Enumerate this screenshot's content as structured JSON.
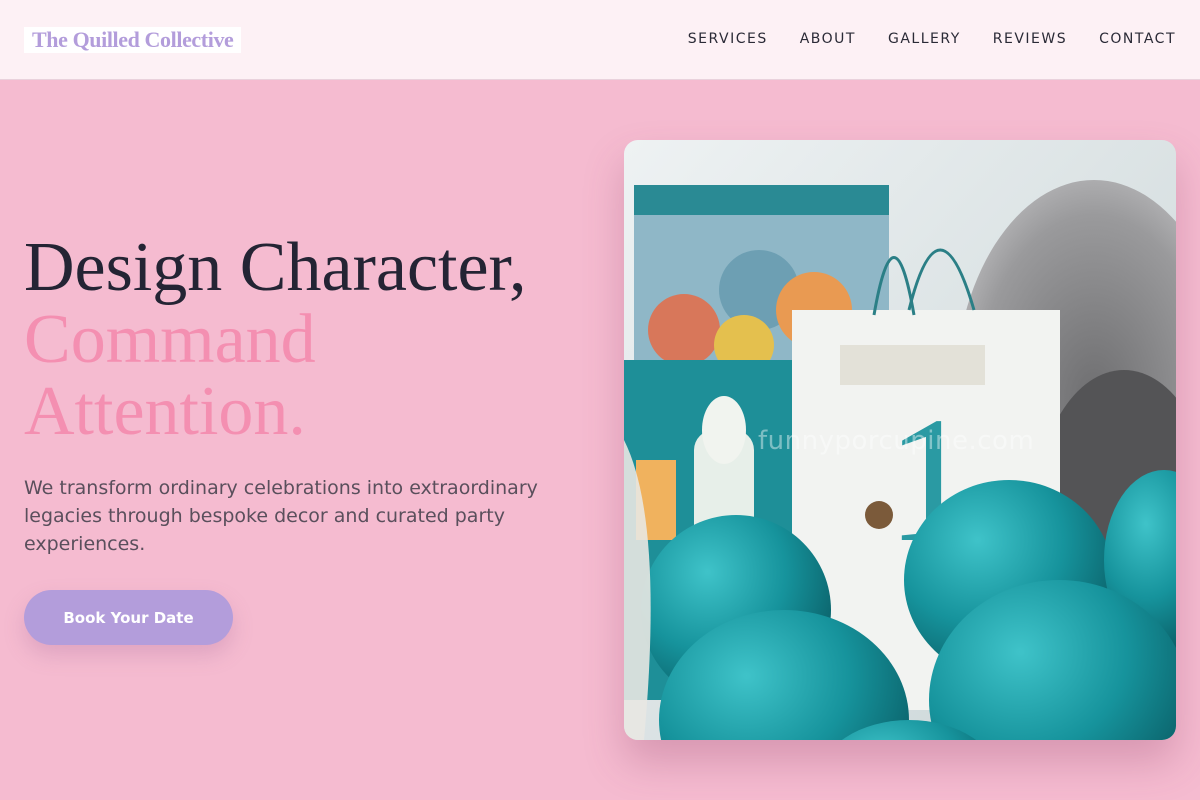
{
  "header": {
    "logo": "The Quilled Collective",
    "nav": [
      "SERVICES",
      "ABOUT",
      "GALLERY",
      "REVIEWS",
      "CONTACT"
    ]
  },
  "hero": {
    "title_line1": "Design Character,",
    "title_line2": "Command",
    "title_line3": "Attention.",
    "subtitle": "We transform ordinary celebrations into extraordinary legacies through bespoke decor and curated party experiences.",
    "cta_label": "Book Your Date",
    "photo_watermark": "funnyporcupine.com",
    "bag_number": "1"
  },
  "colors": {
    "page_bg": "#f5bbd0",
    "header_bg": "#fdf1f5",
    "accent_pink": "#f48fb1",
    "accent_lavender": "#b39ddb",
    "heading_dark": "#242434",
    "balloon_teal": "#18909a"
  }
}
